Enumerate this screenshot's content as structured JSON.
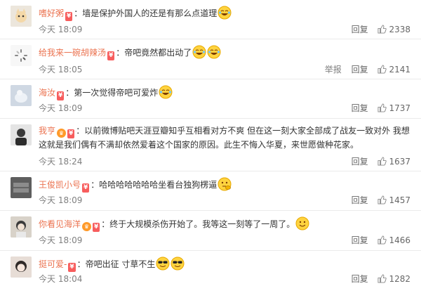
{
  "labels": {
    "reply": "回复",
    "report": "举报"
  },
  "comments": [
    {
      "user": "嗜好粥",
      "text": "：墙是保护外国人的还是有那么点道理",
      "time": "今天 18:09",
      "likes": "2338",
      "has_report": false,
      "vip": false,
      "emoji": "laugh-cry",
      "avatar_color": "#e8e0d4"
    },
    {
      "user": "给我来一碗胡辣汤",
      "text": "：帝吧竟然都出动了",
      "time": "今天 18:05",
      "likes": "2141",
      "has_report": true,
      "vip": false,
      "emoji": "laugh-cry-double",
      "avatar_color": "#f2f2f2"
    },
    {
      "user": "海汝",
      "text": "：第一次觉得帝吧可爱炸",
      "time": "今天 18:09",
      "likes": "1737",
      "has_report": false,
      "vip": false,
      "emoji": "laugh-cry",
      "avatar_color": "#c9d2dc"
    },
    {
      "user": "我亨",
      "text": "：以前微博贴吧天涯豆瓣知乎互相看对方不爽 但在这一刻大家全部成了战友一致对外 我想这就是我们偶有不满却依然爱着这个国家的原因。此生不悔入华夏，来世愿做种花家。",
      "time": "今天 18:24",
      "likes": "1637",
      "has_report": false,
      "vip": true,
      "emoji": "",
      "avatar_color": "#8a8f98"
    },
    {
      "user": "王俊凯小号",
      "text": "：哈哈哈哈哈哈哈坐看台独狗楞逼",
      "time": "今天 18:09",
      "likes": "1457",
      "has_report": false,
      "vip": false,
      "emoji": "thinking",
      "avatar_color": "#6b6b6b"
    },
    {
      "user": "你看见海洋",
      "text": "：终于大规模杀伤开始了。我等这一刻等了一周了。",
      "time": "今天 18:09",
      "likes": "1466",
      "has_report": false,
      "vip": true,
      "emoji": "smile",
      "avatar_color": "#b5b0aa"
    },
    {
      "user": "挺可爱-",
      "text": "：帝吧出征 寸草不生",
      "time": "今天 18:04",
      "likes": "1282",
      "has_report": false,
      "vip": false,
      "emoji": "cool-double",
      "avatar_color": "#d4c8c0"
    }
  ],
  "colors": {
    "username": "#eb7350",
    "badge": "#f75d5d",
    "meta": "#808080"
  }
}
